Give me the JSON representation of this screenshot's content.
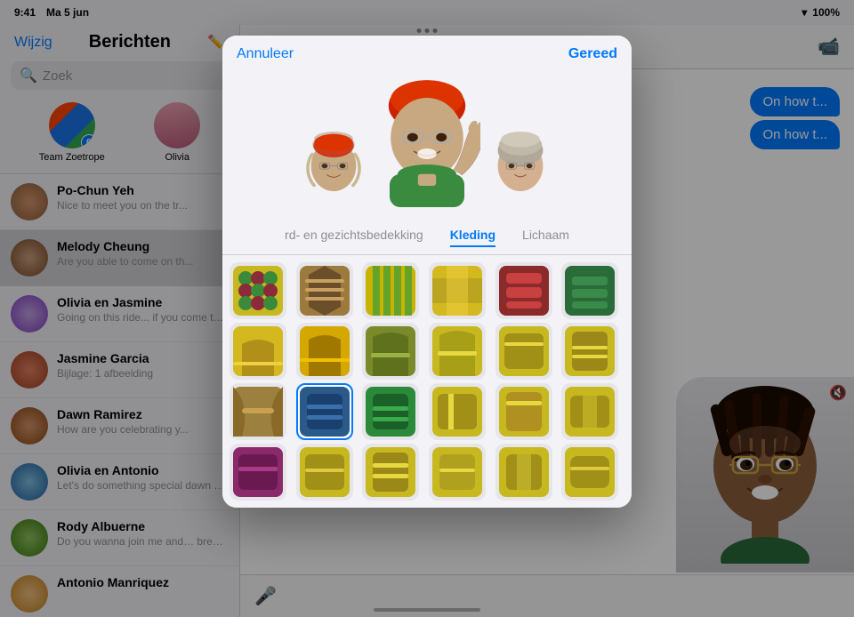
{
  "statusBar": {
    "time": "9:41",
    "date": "Ma 5 jun",
    "wifi": "WiFi",
    "battery": "100%"
  },
  "sidebar": {
    "title": "Berichten",
    "editBtn": "Wijzig",
    "searchPlaceholder": "Zoek",
    "pinnedContacts": [
      {
        "id": "team-zoetrope",
        "label": "Team Zoetrope",
        "badge": "6"
      },
      {
        "id": "olivia",
        "label": "Olivia",
        "badge": ""
      }
    ],
    "conversations": [
      {
        "name": "Po-Chun Yeh",
        "preview": "Nice to meet you on the tr...",
        "active": false
      },
      {
        "name": "Melody Cheung",
        "preview": "Are you able to come on the ride or not?",
        "active": true
      },
      {
        "name": "Olivia en Jasmine",
        "preview": "Going on this ride… if you come too you're welcome",
        "active": false
      },
      {
        "name": "Jasmine Garcia",
        "preview": "Bijlage: 1 afbeelding",
        "active": false
      },
      {
        "name": "Dawn Ramirez",
        "preview": "How are you celebrating your big day?",
        "active": false
      },
      {
        "name": "Olivia en Antonio",
        "preview": "Let's do something special dawn at the next meeting …",
        "active": false
      },
      {
        "name": "Rody Albuerne",
        "preview": "Do you wanna join me and… breakfast?",
        "active": false
      },
      {
        "name": "Antonio Manriquez",
        "preview": "",
        "active": false
      }
    ]
  },
  "chatHeader": {
    "videoBtnLabel": "Video"
  },
  "chatMessages": [
    {
      "text": "On how t...",
      "type": "sent"
    },
    {
      "text": "On how t...",
      "type": "sent"
    }
  ],
  "modal": {
    "cancelLabel": "Annuleer",
    "doneLabel": "Gereed",
    "tabs": [
      {
        "id": "hoofd",
        "label": "rd- en gezichtsbedekking",
        "active": false
      },
      {
        "id": "kleding",
        "label": "Kleding",
        "active": true
      },
      {
        "id": "lichaam",
        "label": "Lichaam",
        "active": false
      }
    ],
    "clothingGrid": [
      {
        "id": "c1",
        "colors": [
          "#c8b820",
          "#8a9c2a",
          "#d4a000"
        ],
        "selected": false
      },
      {
        "id": "c2",
        "colors": [
          "#9c7a3c",
          "#6b4e2a",
          "#c8a060"
        ],
        "selected": false
      },
      {
        "id": "c3",
        "colors": [
          "#d4b800",
          "#8aad2a",
          "#f0c800"
        ],
        "selected": false
      },
      {
        "id": "c4",
        "colors": [
          "#c8b820",
          "#e8d060",
          "#a09020"
        ],
        "selected": false
      },
      {
        "id": "c5",
        "colors": [
          "#8a2a2a",
          "#c84040",
          "#6b1a1a"
        ],
        "selected": false
      },
      {
        "id": "c6",
        "colors": [
          "#2a6b3a",
          "#1a4a2a",
          "#3a8a4a"
        ],
        "selected": false
      },
      {
        "id": "c7",
        "colors": [
          "#c8b820",
          "#a09020",
          "#e8d060"
        ],
        "selected": false
      },
      {
        "id": "c8",
        "colors": [
          "#d4a000",
          "#a07800",
          "#f0c000"
        ],
        "selected": false
      },
      {
        "id": "c9",
        "colors": [
          "#6b8a2a",
          "#4a6a1a",
          "#8aad3a"
        ],
        "selected": false
      },
      {
        "id": "c10",
        "colors": [
          "#c8b820",
          "#d4a000",
          "#a09020"
        ],
        "selected": false
      },
      {
        "id": "c11",
        "colors": [
          "#c8b820",
          "#a09020",
          "#e0c840"
        ],
        "selected": false
      },
      {
        "id": "c12",
        "colors": [
          "#c8b820",
          "#8a7818",
          "#d4a828"
        ],
        "selected": false
      },
      {
        "id": "c13",
        "colors": [
          "#9c8040",
          "#6b5a28",
          "#c8a050"
        ],
        "selected": false
      },
      {
        "id": "c14",
        "colors": [
          "#2a5a8a",
          "#1a4070",
          "#3a70aa"
        ],
        "selected": true
      },
      {
        "id": "c15",
        "colors": [
          "#2a8a3a",
          "#1a6028",
          "#3aaa4a"
        ],
        "selected": false
      },
      {
        "id": "c16",
        "colors": [
          "#c8b820",
          "#a09020",
          "#e8d060"
        ],
        "selected": false
      },
      {
        "id": "c17",
        "colors": [
          "#c8b820",
          "#d4a000",
          "#b08818"
        ],
        "selected": false
      },
      {
        "id": "c18",
        "colors": [
          "#c8b820",
          "#a09020",
          "#e0c840"
        ],
        "selected": false
      },
      {
        "id": "c19",
        "colors": [
          "#8a2a6a",
          "#5a1a48",
          "#aa3a88"
        ],
        "selected": false
      },
      {
        "id": "c20",
        "colors": [
          "#c8b820",
          "#a09020",
          "#e0c840"
        ],
        "selected": false
      },
      {
        "id": "c21",
        "colors": [
          "#c8b820",
          "#8a7818",
          "#d4a828"
        ],
        "selected": false
      },
      {
        "id": "c22",
        "colors": [
          "#c8b820",
          "#a09020",
          "#e8d060"
        ],
        "selected": false
      },
      {
        "id": "c23",
        "colors": [
          "#c8b820",
          "#d4a000",
          "#a09020"
        ],
        "selected": false
      },
      {
        "id": "c24",
        "colors": [
          "#c8b820",
          "#a09020",
          "#e0c840"
        ],
        "selected": false
      }
    ]
  }
}
